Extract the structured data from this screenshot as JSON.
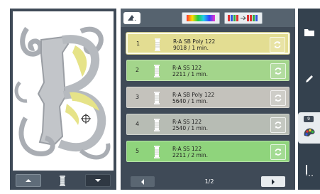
{
  "threads": [
    {
      "number": "1",
      "name": "R-A SB Poly 122",
      "info": "9018 / 1 min.",
      "color": "#e3dd92",
      "selected": true
    },
    {
      "number": "2",
      "name": "R-A SS 122",
      "info": "2211 / 1 min.",
      "color": "#a3d58b",
      "selected": false
    },
    {
      "number": "3",
      "name": "R-A SB Poly 122",
      "info": "5640 / 1 min.",
      "color": "#c4c2bc",
      "selected": false
    },
    {
      "number": "4",
      "name": "R-A SS 122",
      "info": "2540 / 1 min.",
      "color": "#b7bcb4",
      "selected": false
    },
    {
      "number": "5",
      "name": "R-A SS 122",
      "info": "2211 / 2 min.",
      "color": "#8fd47c",
      "selected": false
    }
  ],
  "pager": {
    "label": "1/2"
  },
  "sidebar": {
    "color_count": "9"
  },
  "colors": {
    "panel": "#3f4a57",
    "toolbar": "#56636f",
    "sidebar": "#34414e",
    "accent_yellow": "#e6e388"
  }
}
